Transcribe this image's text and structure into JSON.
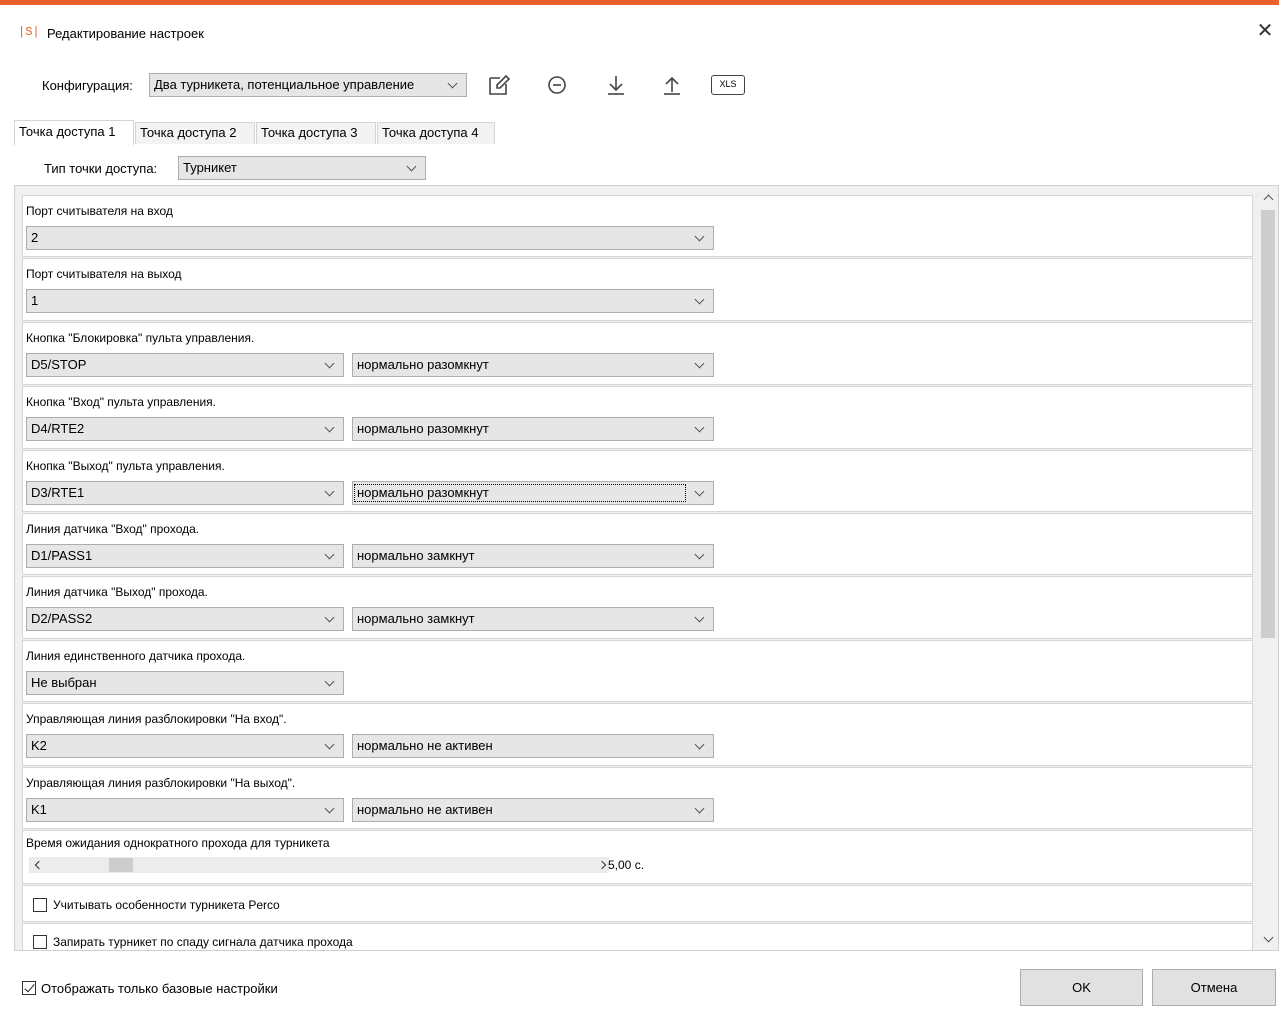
{
  "window": {
    "icon_text": "|S|",
    "title": "Редактирование настроек",
    "close_symbol": "✕"
  },
  "toolbar": {
    "config_label": "Конфигурация:",
    "config_value": "Два турникета, потенциальное управление",
    "icons": [
      "edit-icon",
      "remove-icon",
      "download-icon",
      "upload-icon",
      "xls-export-icon"
    ],
    "xls_text": "XLS"
  },
  "tabs": [
    {
      "label": "Точка доступа 1",
      "active": true
    },
    {
      "label": "Точка доступа 2",
      "active": false
    },
    {
      "label": "Точка доступа 3",
      "active": false
    },
    {
      "label": "Точка доступа 4",
      "active": false
    }
  ],
  "access_point_type": {
    "label": "Тип точки доступа:",
    "value": "Турникет"
  },
  "settings": [
    {
      "label": "Порт считывателя на вход",
      "value1": "2",
      "value2": null
    },
    {
      "label": "Порт считывателя на выход",
      "value1": "1",
      "value2": null
    },
    {
      "label": "Кнопка \"Блокировка\" пульта управления.",
      "value1": "D5/STOP",
      "value2": "нормально разомкнут"
    },
    {
      "label": "Кнопка \"Вход\" пульта управления.",
      "value1": "D4/RTE2",
      "value2": "нормально разомкнут"
    },
    {
      "label": "Кнопка \"Выход\" пульта управления.",
      "value1": "D3/RTE1",
      "value2": "нормально разомкнут"
    },
    {
      "label": "Линия датчика \"Вход\" прохода.",
      "value1": "D1/PASS1",
      "value2": "нормально замкнут"
    },
    {
      "label": "Линия датчика \"Выход\" прохода.",
      "value1": "D2/PASS2",
      "value2": "нормально замкнут"
    },
    {
      "label": "Линия единственного датчика прохода.",
      "value1": "Не выбран",
      "value2": null
    },
    {
      "label": "Управляющая линия разблокировки \"На вход\".",
      "value1": "K2",
      "value2": "нормально не активен"
    },
    {
      "label": "Управляющая линия разблокировки \"На выход\".",
      "value1": "K1",
      "value2": "нормально не активен"
    }
  ],
  "timeout": {
    "label": "Время ожидания однократного прохода для турникета",
    "value": "5,00 с."
  },
  "checkboxes": [
    {
      "label": "Учитывать особенности турникета Perco",
      "checked": false
    },
    {
      "label": "Запирать турникет по спаду сигнала датчика прохода",
      "checked": false
    }
  ],
  "footer": {
    "basic_only_label": "Отображать только базовые настройки",
    "basic_only_checked": true,
    "ok_label": "OK",
    "cancel_label": "Отмена"
  }
}
